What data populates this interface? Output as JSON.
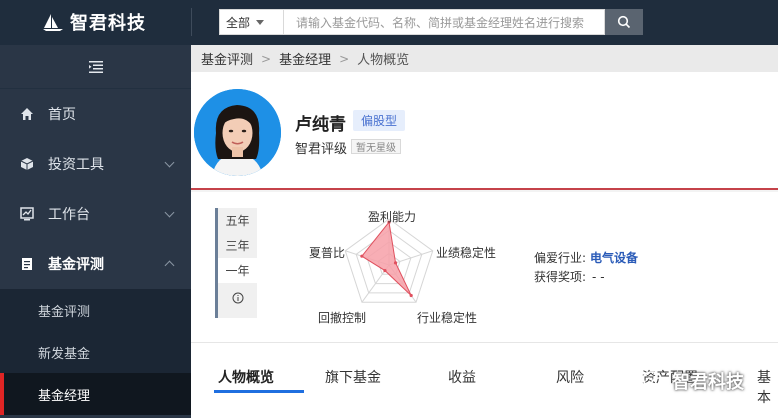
{
  "header": {
    "logo_text": "智君科技",
    "search": {
      "scope": "全部",
      "placeholder": "请输入基金代码、名称、简拼或基金经理姓名进行搜索"
    }
  },
  "sidebar": {
    "items": [
      {
        "label": "首页",
        "icon": "home-icon"
      },
      {
        "label": "投资工具",
        "icon": "cube-icon"
      },
      {
        "label": "工作台",
        "icon": "chart-icon"
      },
      {
        "label": "基金评测",
        "icon": "doc-icon"
      }
    ],
    "subitems": [
      {
        "label": "基金评测"
      },
      {
        "label": "新发基金"
      },
      {
        "label": "基金经理"
      }
    ]
  },
  "breadcrumb": [
    "基金评测",
    "基金经理",
    "人物概览"
  ],
  "profile": {
    "name": "卢纯青",
    "style_tag": "偏股型",
    "rating_label": "智君评级",
    "rating_value": "暂无星级"
  },
  "periods": [
    "五年",
    "三年",
    "一年"
  ],
  "selected_period": "一年",
  "radar": {
    "labels": [
      "盈利能力",
      "业绩稳定性",
      "行业稳定性",
      "回撤控制",
      "夏普比"
    ],
    "values": [
      0.93,
      0.15,
      0.82,
      0.15,
      0.62
    ],
    "fill_color": "#f7a0a8",
    "stroke_color": "#e0505e"
  },
  "meta": {
    "industry_label": "偏爱行业:",
    "industry_value": "电气设备",
    "award_label": "获得奖项:",
    "award_value": "- -"
  },
  "tabs": [
    "人物概览",
    "旗下基金",
    "收益",
    "风险",
    "资产配置",
    "基本"
  ],
  "watermark": "智君科技"
}
